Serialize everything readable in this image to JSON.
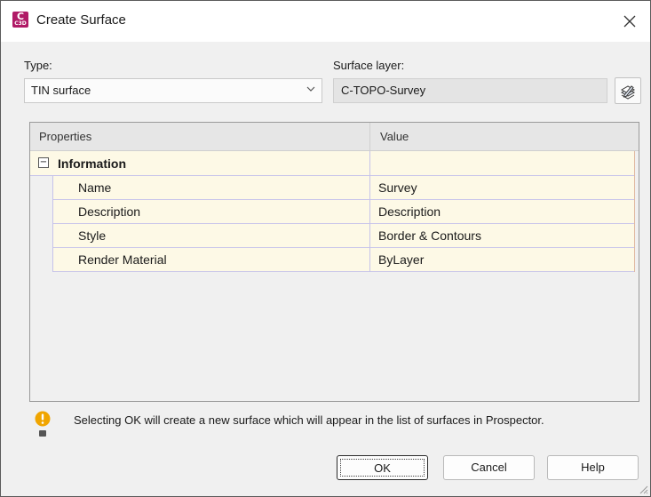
{
  "window": {
    "title": "Create Surface",
    "app_icon": {
      "letter": "C",
      "sub": "C3D",
      "color": "#b01a66"
    },
    "close_icon": "close-icon"
  },
  "type": {
    "label": "Type:",
    "value": "TIN surface"
  },
  "surface_layer": {
    "label": "Surface layer:",
    "value": "C-TOPO-Survey",
    "button_icon": "layer-icon"
  },
  "grid": {
    "headers": {
      "properties": "Properties",
      "value": "Value"
    },
    "group": {
      "toggle": "⊟",
      "label": "Information"
    },
    "rows": [
      {
        "name": "Name",
        "value": "Survey"
      },
      {
        "name": "Description",
        "value": "Description"
      },
      {
        "name": "Style",
        "value": "Border & Contours"
      },
      {
        "name": "Render Material",
        "value": "ByLayer"
      }
    ]
  },
  "note": {
    "icon": "warning-icon",
    "text": "Selecting OK will create a new surface which will appear in the list of surfaces in Prospector."
  },
  "buttons": {
    "ok": "OK",
    "cancel": "Cancel",
    "help": "Help"
  },
  "colors": {
    "row_background": "#fdf9e6",
    "row_border": "#c6c3ea",
    "warning": "#f0a500"
  }
}
